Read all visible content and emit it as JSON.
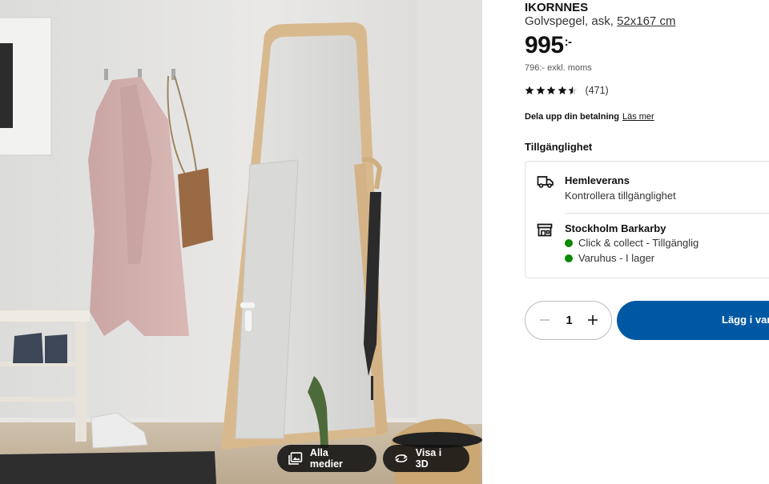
{
  "product": {
    "name": "IKORNNES",
    "description": "Golvspegel, ask, ",
    "size": "52x167 cm",
    "price": "995",
    "price_suffix": ":-",
    "price_excl_vat": "796:- exkl. moms",
    "rating": 4.5,
    "rating_max": 5,
    "rating_count": "(471)"
  },
  "payment": {
    "text": "Dela upp din betalning",
    "link": "Läs mer"
  },
  "availability": {
    "heading": "Tillgänglighet",
    "delivery": {
      "icon": "truck-icon",
      "title": "Hemleverans",
      "subtitle": "Kontrollera tillgänglighet"
    },
    "store": {
      "icon": "store-icon",
      "title": "Stockholm Barkarby",
      "lines": [
        {
          "text": "Click & collect - Tillgänglig",
          "status_color": "#0a8a00"
        },
        {
          "text": "Varuhus - I lager",
          "status_color": "#0a8a00"
        }
      ]
    }
  },
  "purchase": {
    "quantity": "1",
    "add_label": "Lägg i var",
    "accent_color": "#0058a3"
  },
  "media": {
    "all_media_label": "Alla medier",
    "view_3d_label": "Visa i 3D"
  }
}
